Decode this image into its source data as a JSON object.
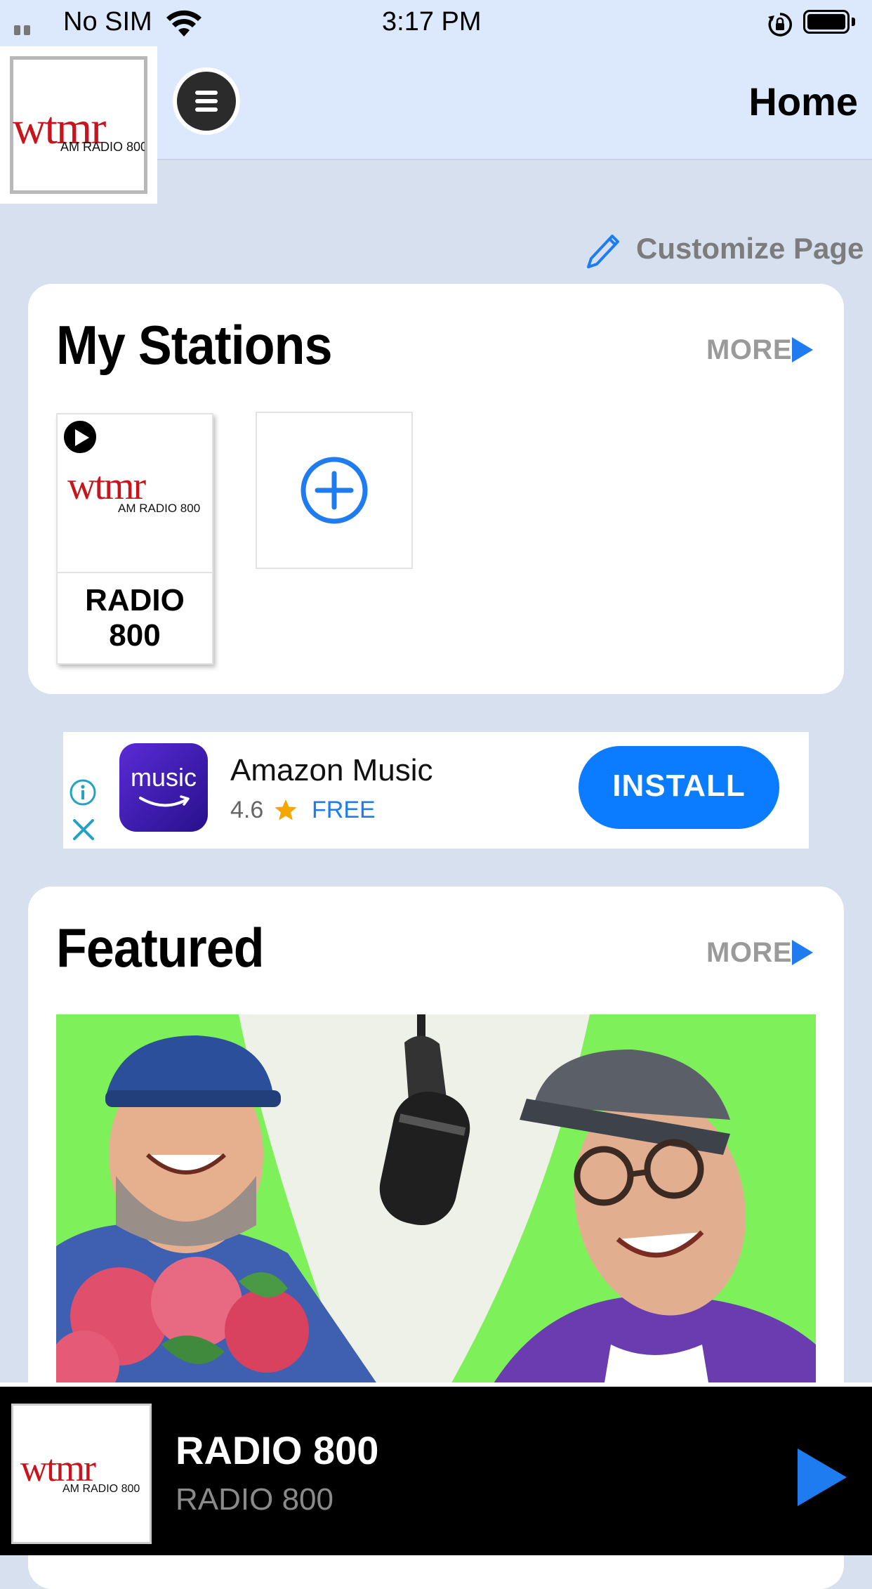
{
  "status_bar": {
    "carrier": "No SIM",
    "time": "3:17 PM"
  },
  "header": {
    "title": "Home",
    "logo": {
      "brand": "wtmr",
      "sub": "AM RADIO 800"
    }
  },
  "customize": {
    "label": "Customize Page"
  },
  "my_stations": {
    "title": "My Stations",
    "more_label": "MORE",
    "stations": [
      {
        "name": "RADIO 800",
        "logo_brand": "wtmr",
        "logo_sub": "AM RADIO 800"
      }
    ]
  },
  "ad": {
    "app_icon_text": "music",
    "app_name": "Amazon Music",
    "rating": "4.6",
    "price": "FREE",
    "cta_label": "INSTALL"
  },
  "featured": {
    "title": "Featured",
    "more_label": "MORE"
  },
  "player": {
    "title": "RADIO 800",
    "subtitle": "RADIO 800",
    "logo_brand": "wtmr",
    "logo_sub": "AM RADIO 800"
  },
  "colors": {
    "accent": "#1e7bf0",
    "header_bg": "#dce8fb",
    "page_bg": "#d6e0ee",
    "logo_red": "#c8141c",
    "featured_green": "#7ef05a"
  }
}
